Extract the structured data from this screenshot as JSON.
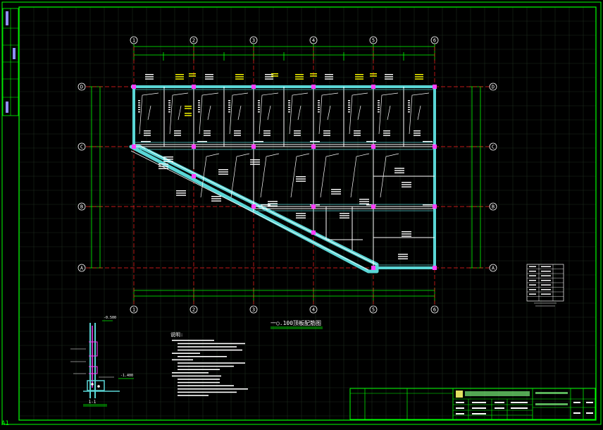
{
  "sheet": {
    "sheet_size_label": "A1",
    "plan_title": "一○.100顶板配筋图",
    "notes_title": "说明:"
  },
  "grid": {
    "columns": [
      "1",
      "2",
      "3",
      "4",
      "5",
      "6"
    ],
    "rows": [
      "D",
      "C",
      "B",
      "A"
    ]
  },
  "detail": {
    "section_label": "1-1",
    "level_top": "-0.500",
    "level_bottom": "-1.400"
  },
  "colors": {
    "background": "#000000",
    "frame": "#00ff00",
    "wall_fill": "#5ad6d6",
    "beam_line": "#ffffff",
    "axis_line": "#ff2020",
    "dimension": "#00ff00",
    "annotation": "#ffffff",
    "highlight": "#ffff00",
    "column": "#ff40ff"
  }
}
